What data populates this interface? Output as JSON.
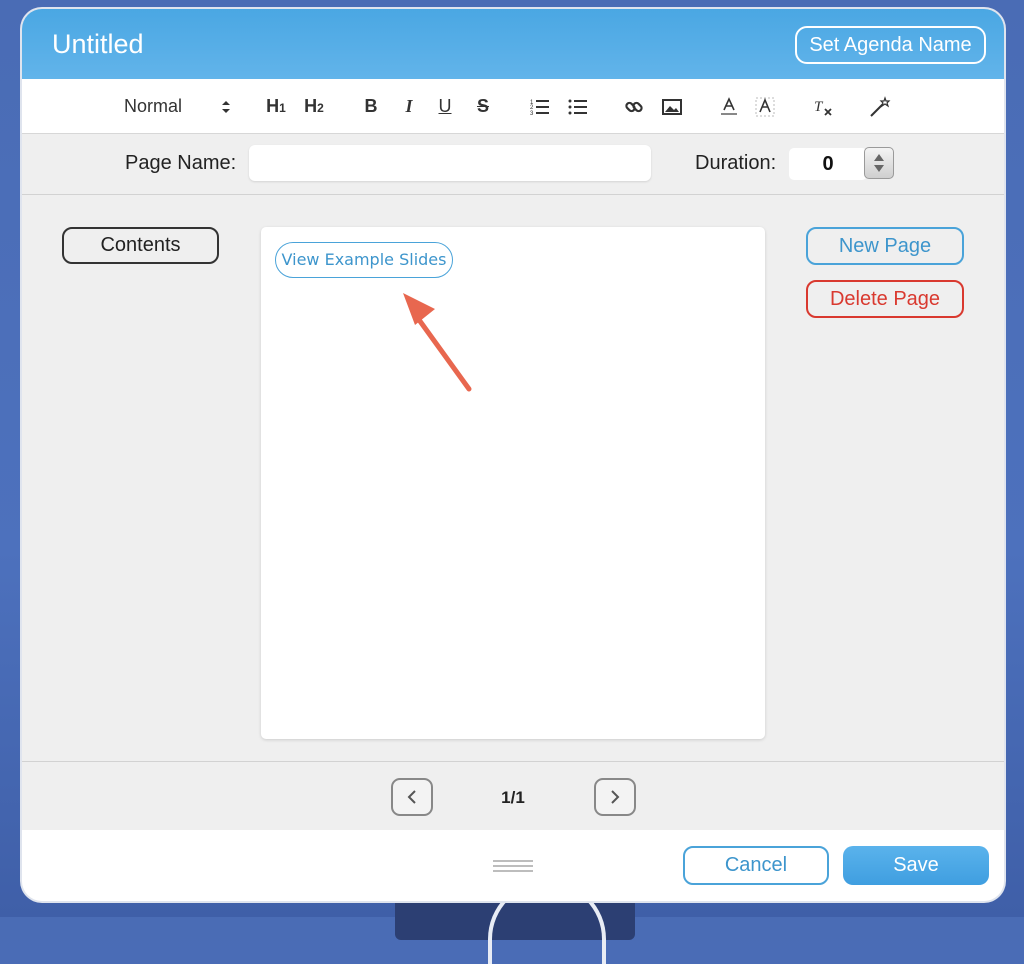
{
  "dialog": {
    "title": "Untitled",
    "set_name_label": "Set Agenda Name"
  },
  "toolbar": {
    "format_select": "Normal",
    "buttons": [
      "heading-1",
      "heading-2",
      "bold",
      "italic",
      "underline",
      "strikethrough",
      "ordered-list",
      "bullet-list",
      "link",
      "image",
      "text-color",
      "highlight",
      "clear-format",
      "magic-wand"
    ]
  },
  "fields": {
    "page_name_label": "Page Name:",
    "page_name_value": "",
    "duration_label": "Duration:",
    "duration_value": "0"
  },
  "sidebar": {
    "contents_label": "Contents"
  },
  "slide": {
    "example_button_label": "View Example Slides"
  },
  "actions": {
    "new_page_label": "New Page",
    "delete_page_label": "Delete Page"
  },
  "pager": {
    "count": "1/1"
  },
  "footer": {
    "cancel_label": "Cancel",
    "save_label": "Save"
  },
  "colors": {
    "accent": "#4aa3d9",
    "danger": "#d9392f",
    "annotation_arrow": "#e8674f"
  }
}
